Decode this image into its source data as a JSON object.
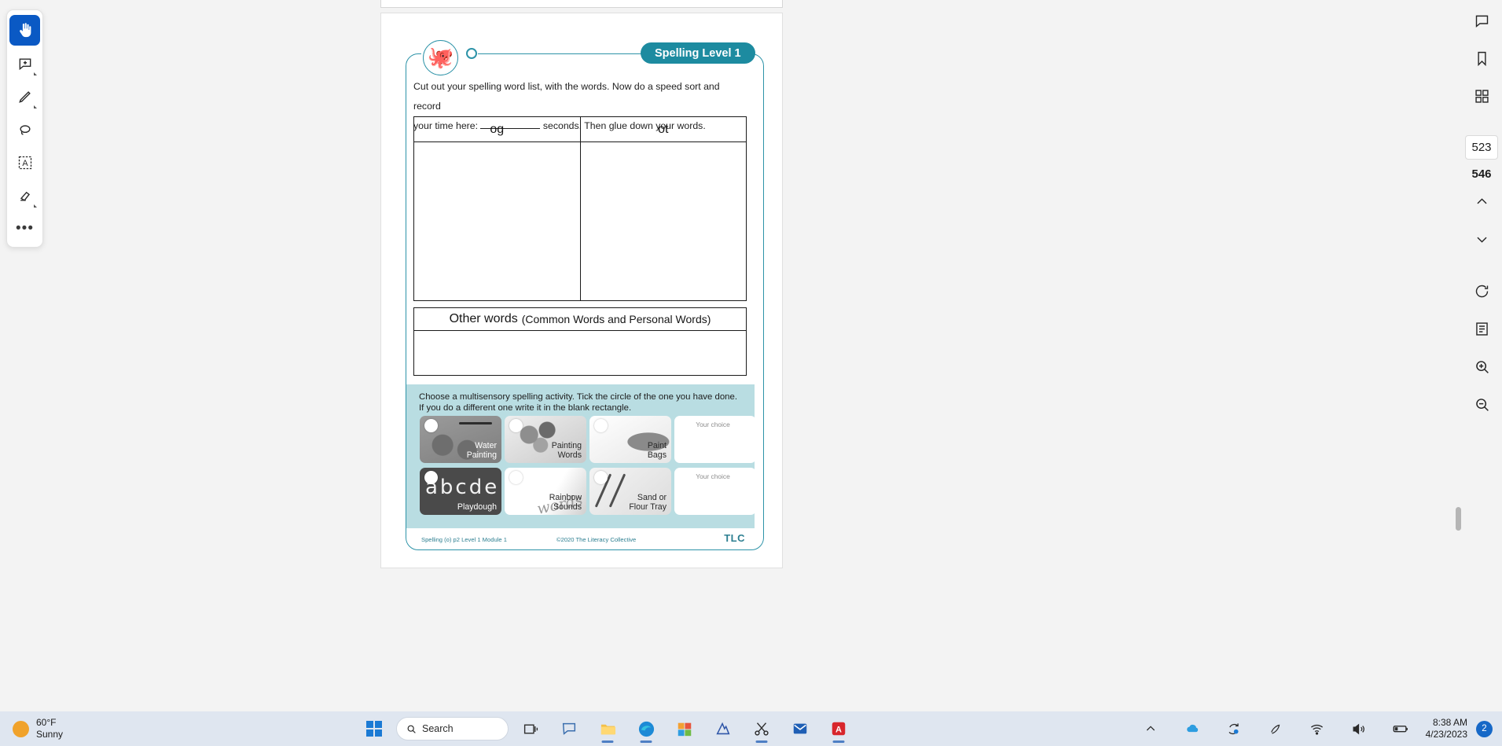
{
  "toolbar": {
    "tools": [
      {
        "name": "pan-hand-tool",
        "icon": "hand-icon",
        "active": true
      },
      {
        "name": "add-comment-tool",
        "icon": "comment-plus-icon",
        "active": false
      },
      {
        "name": "highlighter-tool",
        "icon": "pen-icon",
        "active": false
      },
      {
        "name": "lasso-eraser-tool",
        "icon": "lasso-icon",
        "active": false
      },
      {
        "name": "text-select-tool",
        "icon": "text-box-icon",
        "active": false
      },
      {
        "name": "ink-eraser-tool",
        "icon": "eraser-icon",
        "active": false
      },
      {
        "name": "more-tools",
        "icon": "ellipsis-icon",
        "active": false
      }
    ]
  },
  "rail": {
    "buttons": [
      {
        "name": "comments-panel-button",
        "icon": "comment-icon"
      },
      {
        "name": "bookmarks-button",
        "icon": "bookmark-icon"
      },
      {
        "name": "thumbnails-button",
        "icon": "grid-icon"
      }
    ],
    "current_page": "523",
    "total_pages": "546",
    "nav": [
      {
        "name": "previous-page-button",
        "icon": "chevron-up-icon"
      },
      {
        "name": "next-page-button",
        "icon": "chevron-down-icon"
      }
    ],
    "actions": [
      {
        "name": "rotate-button",
        "icon": "rotate-icon"
      },
      {
        "name": "fit-page-button",
        "icon": "fit-page-icon"
      },
      {
        "name": "zoom-in-button",
        "icon": "zoom-in-icon"
      },
      {
        "name": "zoom-out-button",
        "icon": "zoom-out-icon"
      }
    ]
  },
  "worksheet": {
    "mascot_icon": "octopus-icon",
    "badge_label": "Spelling Level 1",
    "instruction_part1": "Cut out your spelling word list, with the words. Now do a speed sort and record",
    "instruction_part2a": "your time here:",
    "instruction_part2b": "seconds. Then glue down your words.",
    "sort_columns": [
      "og",
      "ot"
    ],
    "other_words_title": "Other words",
    "other_words_subtitle": "(Common Words and Personal Words)",
    "multisensory": {
      "instruction_line1": "Choose a multisensory spelling activity. Tick the circle of the one you have done.",
      "instruction_line2": "If you do a different one write it in the blank rectangle.",
      "cards": [
        {
          "name": "activity-card-water-painting",
          "label": "Water\nPainting",
          "style": "dark",
          "bg": "bg-water"
        },
        {
          "name": "activity-card-painting-words",
          "label": "Painting\nWords",
          "style": "light",
          "bg": "bg-paint"
        },
        {
          "name": "activity-card-paint-bags",
          "label": "Paint\nBags",
          "style": "light",
          "bg": "bg-bags"
        },
        {
          "name": "activity-card-your-choice-1",
          "label": "Your choice",
          "style": "blank",
          "bg": ""
        },
        {
          "name": "activity-card-playdough",
          "label": "Playdough",
          "style": "dark",
          "bg": "bg-play"
        },
        {
          "name": "activity-card-rainbow-sounds",
          "label": "Rainbow\nSounds",
          "style": "light",
          "bg": "bg-rain"
        },
        {
          "name": "activity-card-sand-flour-tray",
          "label": "Sand or\nFlour Tray",
          "style": "light",
          "bg": "bg-sand"
        },
        {
          "name": "activity-card-your-choice-2",
          "label": "Your choice",
          "style": "blank",
          "bg": ""
        }
      ]
    },
    "footer_left": "Spelling (o)  p2 Level 1  Module 1",
    "footer_center": "©2020 The Literacy Collective",
    "footer_right": "TLC"
  },
  "taskbar": {
    "weather_temp": "60°F",
    "weather_desc": "Sunny",
    "search_placeholder": "Search",
    "apps": [
      {
        "name": "taskbar-task-view",
        "icon": "task-view-icon",
        "active": false
      },
      {
        "name": "taskbar-chat",
        "icon": "chat-icon",
        "active": false
      },
      {
        "name": "taskbar-file-explorer",
        "icon": "folder-icon",
        "active": true
      },
      {
        "name": "taskbar-edge",
        "icon": "edge-icon",
        "active": true
      },
      {
        "name": "taskbar-store",
        "icon": "store-icon",
        "active": false
      },
      {
        "name": "taskbar-editor",
        "icon": "editor-icon",
        "active": false
      },
      {
        "name": "taskbar-snipping-tool",
        "icon": "scissors-icon",
        "active": true
      },
      {
        "name": "taskbar-outlook",
        "icon": "outlook-icon",
        "active": false
      },
      {
        "name": "taskbar-acrobat",
        "icon": "acrobat-icon",
        "active": true
      }
    ],
    "tray": [
      {
        "name": "show-hidden-icons",
        "icon": "chevron-up-icon"
      },
      {
        "name": "onedrive-icon",
        "icon": "cloud-icon"
      },
      {
        "name": "sync-icon",
        "icon": "sync-icon"
      },
      {
        "name": "pen-tray-icon",
        "icon": "pen-icon"
      },
      {
        "name": "wifi-icon",
        "icon": "wifi-icon"
      },
      {
        "name": "volume-icon",
        "icon": "speaker-icon"
      },
      {
        "name": "battery-icon",
        "icon": "battery-icon"
      }
    ],
    "clock_time": "8:38 AM",
    "clock_date": "4/23/2023",
    "notification_count": "2"
  },
  "colors": {
    "teal": "#2d93a8",
    "badge": "#1d8ba0",
    "panel": "#b9dde2",
    "accent_blue": "#0a59c4"
  }
}
